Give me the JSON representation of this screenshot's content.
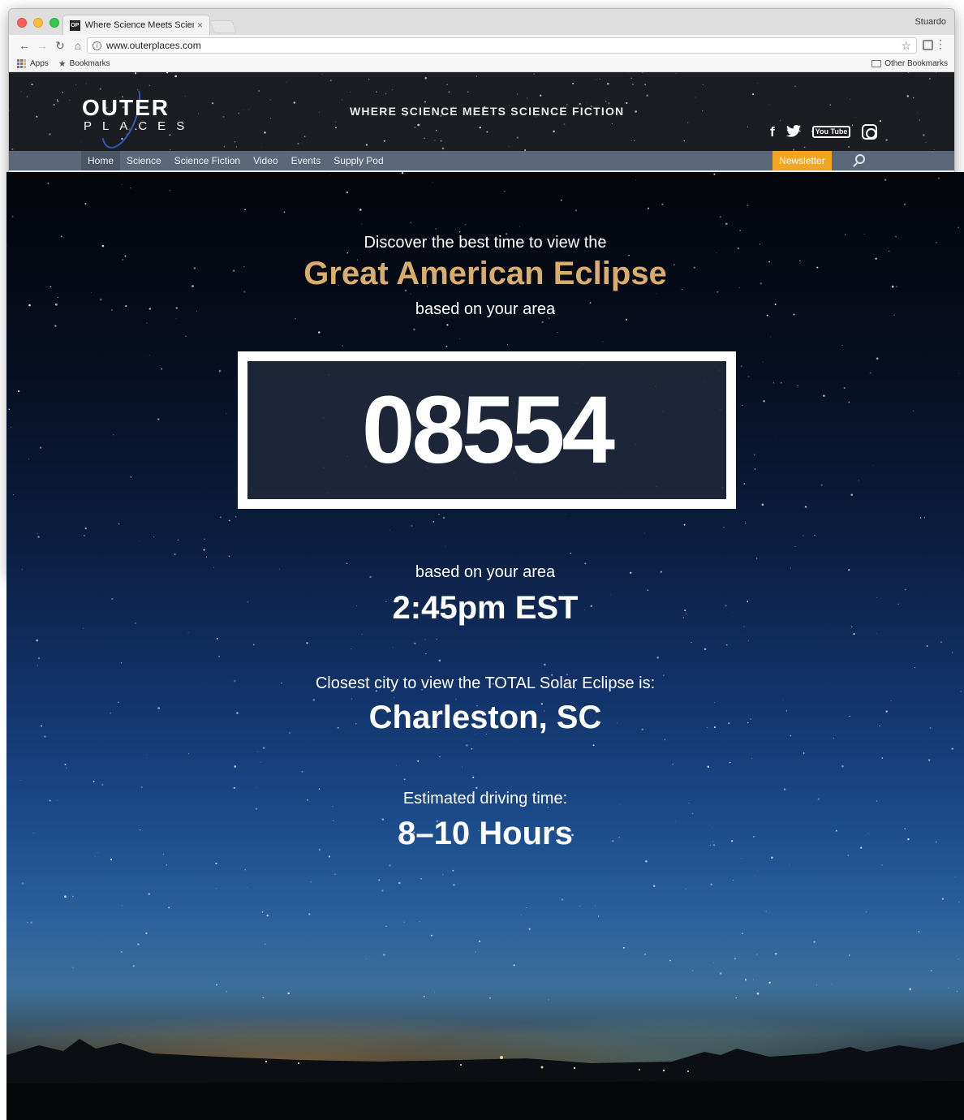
{
  "browser": {
    "tab_title": "Where Science Meets Science",
    "tab_favicon": "OP",
    "profile_name": "Stuardo",
    "url": "www.outerplaces.com",
    "bookmarks": {
      "apps_label": "Apps",
      "bookmarks_label": "Bookmarks",
      "other_label": "Other Bookmarks"
    }
  },
  "site": {
    "logo_top": "OUTER",
    "logo_bottom": "PLACES",
    "tagline": "WHERE SCIENCE MEETS SCIENCE FICTION",
    "social": {
      "facebook": "f",
      "youtube": "You Tube"
    },
    "nav": {
      "items": [
        "Home",
        "Science",
        "Science Fiction",
        "Video",
        "Events",
        "Supply Pod"
      ],
      "active_index": 0,
      "newsletter_label": "Newsletter"
    },
    "icons": [
      "facebook-icon",
      "twitter-icon",
      "youtube-icon",
      "instagram-icon",
      "search-icon"
    ]
  },
  "hero": {
    "intro_line1": "Discover the best time to view the",
    "headline": "Great American Eclipse",
    "intro_line3": "based on your area",
    "zip_code": "08554",
    "time_label": "based on your area",
    "time_value": "2:45pm EST",
    "city_label": "Closest city to view the TOTAL Solar Eclipse is:",
    "city_value": "Charleston, SC",
    "drive_label": "Estimated driving time:",
    "drive_value": "8–10 Hours"
  },
  "colors": {
    "headline": "#d9ad6c",
    "newsletter": "#f2a522",
    "nav_bar": "#5b6879",
    "zip_border": "#ffffff"
  }
}
